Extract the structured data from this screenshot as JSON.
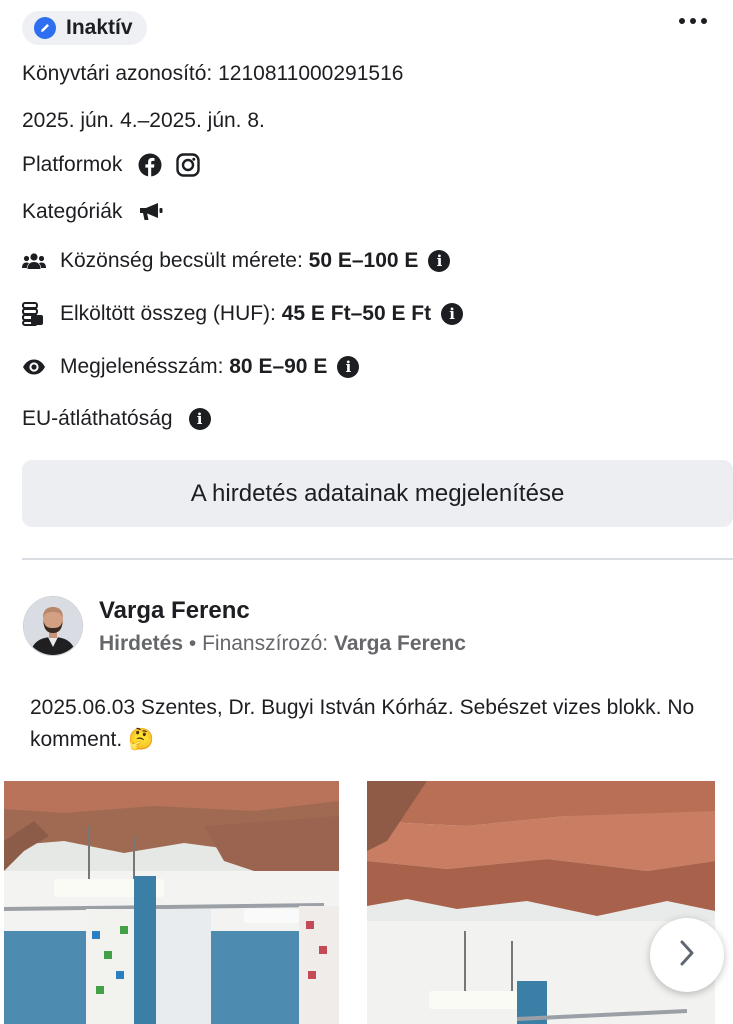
{
  "status": {
    "label": "Inaktív",
    "icon": "pencil-circle-icon",
    "color": "#2d6ff0"
  },
  "menu": {
    "icon": "more-horizontal-icon"
  },
  "library_id": {
    "label": "Könyvtári azonosító:",
    "value": "1210811000291516"
  },
  "date_range": "2025. jún. 4.–2025. jún. 8.",
  "platforms": {
    "label": "Platformok",
    "icons": [
      "facebook-icon",
      "instagram-icon"
    ]
  },
  "categories": {
    "label": "Kategóriák",
    "icon": "megaphone-icon"
  },
  "audience": {
    "label": "Közönség becsült mérete:",
    "value": "50 E–100 E",
    "icon": "people-icon"
  },
  "spend": {
    "label": "Elköltött összeg (HUF):",
    "value": "45 E Ft–50 E Ft",
    "icon": "coins-icon"
  },
  "impressions": {
    "label": "Megjelenésszám:",
    "value": "80 E–90 E",
    "icon": "eye-icon"
  },
  "eu": {
    "label": "EU-átláthatóság"
  },
  "show_details_button": "A hirdetés adatainak megjelenítése",
  "post": {
    "author": "Varga Ferenc",
    "ad_label": "Hirdetés",
    "separator": "•",
    "funded_by_label": "Finanszírozó:",
    "funder": "Varga Ferenc",
    "text": "2025.06.03 Szentes, Dr. Bugyi István Kórház. Sebészet vizes blokk. No komment. 🤔"
  },
  "carousel": {
    "next_icon": "chevron-right-icon"
  }
}
